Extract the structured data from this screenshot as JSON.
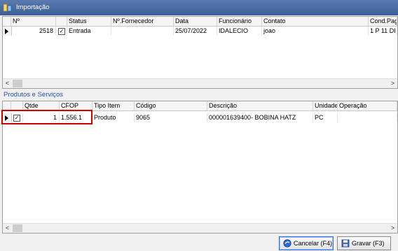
{
  "window": {
    "title": "Importação"
  },
  "top_grid": {
    "columns": [
      "Nº",
      "Status",
      "Nº.Fornecedor",
      "Data",
      "Funcionário",
      "Contato",
      "Cond.Pag"
    ],
    "rows": [
      {
        "numero": "2518",
        "checked": true,
        "status": "Entrada",
        "fornecedor": "",
        "data": "25/07/2022",
        "funcionario": "IDALECIO",
        "contato": "joao",
        "cond_pag": "1 P 11 DI"
      }
    ]
  },
  "section": {
    "title": "Produtos e Serviços"
  },
  "bottom_grid": {
    "columns": [
      "Qtde",
      "CFOP",
      "Tipo Item",
      "Código",
      "Descrição",
      "Unidade",
      "Operação"
    ],
    "rows": [
      {
        "checked": true,
        "qtde": "1",
        "cfop": "1.556.1",
        "tipo_item": "Produto",
        "codigo": "9065",
        "descricao": "000001639400- BOBINA HATZ",
        "unidade": "PC",
        "operacao": ""
      }
    ]
  },
  "buttons": {
    "cancel": "Cancelar (F4)",
    "save": "Gravar (F3)"
  },
  "colors": {
    "highlight": "#d00000",
    "section_title": "#2a4ea8",
    "titlebar": "#3b5e98"
  }
}
